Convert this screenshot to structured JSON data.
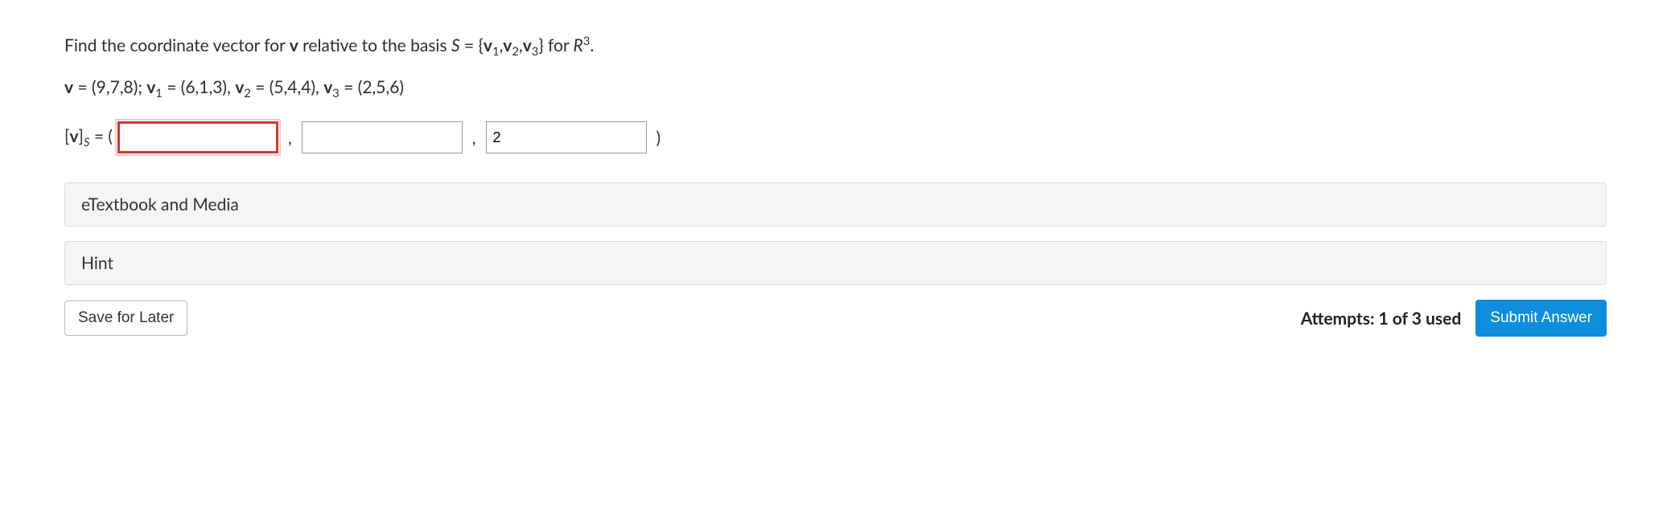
{
  "question": {
    "line1_pre": "Find the coordinate vector for ",
    "line1_bold1": "v",
    "line1_mid": " relative to the basis ",
    "line1_S_italic": "S",
    "line1_eq": " = {",
    "line1_v1": "v",
    "line1_sub1": "1",
    "line1_comma1": ",",
    "line1_v2": "v",
    "line1_sub2": "2",
    "line1_comma2": ",",
    "line1_v3": "v",
    "line1_sub3": "3",
    "line1_close": "} for ",
    "line1_R_italic": "R",
    "line1_sup": "3",
    "line1_period": ".",
    "line2_v": "v",
    "line2_eq1": " = (9,7,8); ",
    "line2_v1": "v",
    "line2_s1": "1",
    "line2_eq2": " = (6,1,3), ",
    "line2_v2": "v",
    "line2_s2": "2",
    "line2_eq3": " = (5,4,4), ",
    "line2_v3": "v",
    "line2_s3": "3",
    "line2_eq4": " = (2,5,6)"
  },
  "answer": {
    "prefix_open": "[",
    "prefix_v": "v",
    "prefix_close": "]",
    "prefix_sub": "S",
    "prefix_eq": " = ( ",
    "input1_value": "",
    "sep1": ",",
    "input2_value": "",
    "sep2": ",",
    "input3_value": "2",
    "close": ")"
  },
  "panels": {
    "etextbook": "eTextbook and Media",
    "hint": "Hint"
  },
  "footer": {
    "save": "Save for Later",
    "attempts": "Attempts: 1 of 3 used",
    "submit": "Submit Answer"
  }
}
